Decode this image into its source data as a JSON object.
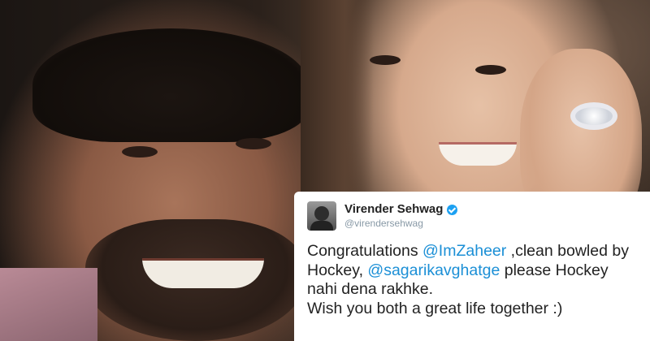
{
  "tweet": {
    "author_name": "Virender Sehwag",
    "author_handle": "@virendersehwag",
    "text_1": "Congratulations ",
    "mention_1": "@ImZaheer",
    "text_2": " ,clean bowled by Hockey, ",
    "mention_2": "@sagarikavghatge",
    "text_3": " please Hockey nahi dena rakhke.",
    "text_4": "Wish you both a great life together :)",
    "mention_color": "#1b8fd6",
    "verified_color": "#1da1f2",
    "icons": {
      "avatar": "profile-photo",
      "verified": "verified-badge-icon"
    }
  }
}
